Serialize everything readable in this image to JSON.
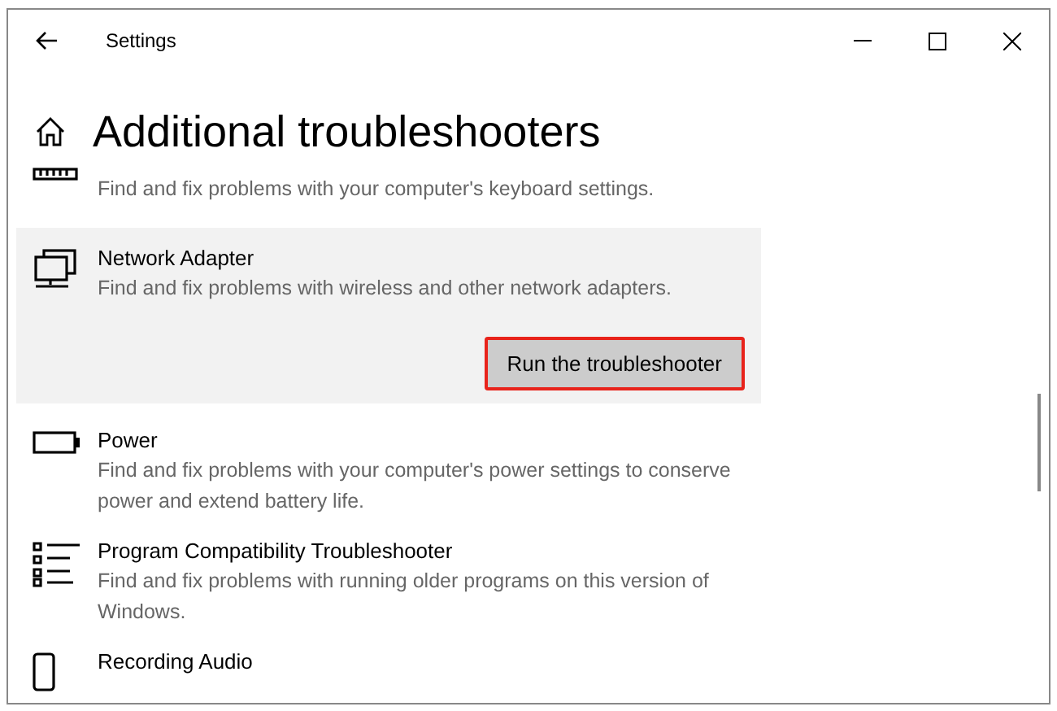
{
  "window": {
    "title": "Settings"
  },
  "page": {
    "title": "Additional troubleshooters"
  },
  "items": [
    {
      "description": "Find and fix problems with your computer's keyboard settings.",
      "selected": false
    },
    {
      "title": "Network Adapter",
      "description": "Find and fix problems with wireless and other network adapters.",
      "selected": true,
      "button": "Run the troubleshooter"
    },
    {
      "title": "Power",
      "description": "Find and fix problems with your computer's power settings to conserve power and extend battery life.",
      "selected": false
    },
    {
      "title": "Program Compatibility Troubleshooter",
      "description": "Find and fix problems with running older programs on this version of Windows.",
      "selected": false
    },
    {
      "title": "Recording Audio",
      "selected": false
    }
  ]
}
